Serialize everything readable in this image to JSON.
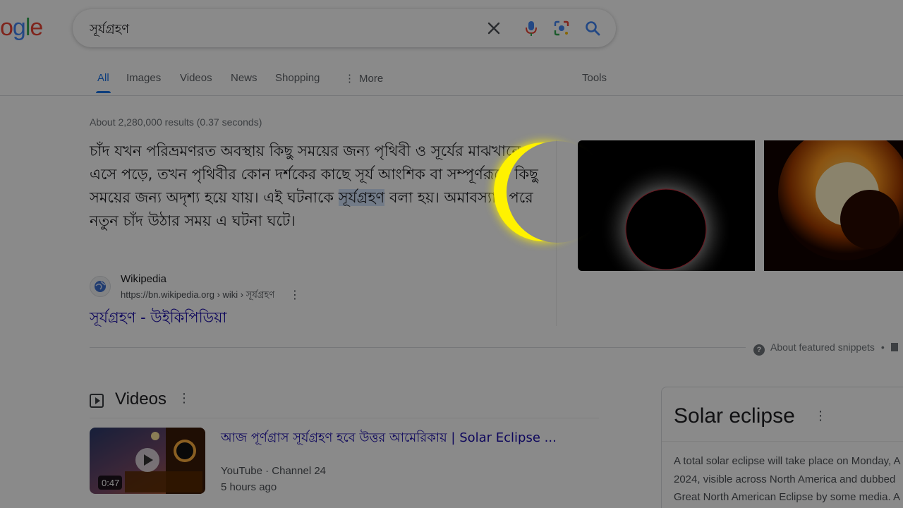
{
  "logo": {
    "part1": "o",
    "part2": "g",
    "part3": "l",
    "part4": "e"
  },
  "search": {
    "query": "সূর্যগ্রহণ"
  },
  "tabs": [
    {
      "label": "All"
    },
    {
      "label": "Images"
    },
    {
      "label": "Videos"
    },
    {
      "label": "News"
    },
    {
      "label": "Shopping"
    },
    {
      "label": "More"
    },
    {
      "label": "Tools"
    }
  ],
  "results_stats": "About 2,280,000 results (0.37 seconds)",
  "snippet": {
    "text_before": "চাঁদ যখন পরিভ্রমণরত অবস্থায় কিছু সময়ের জন্য পৃথিবী ও সূর্যের মাঝখানে এসে পড়ে, তখন পৃথিবীর কোন দর্শকের কাছে সূর্য আংশিক বা সম্পূর্ণরূপে কিছু সময়ের জন্য অদৃশ্য হয়ে যায়। এই ঘটনাকে ",
    "highlight": "সূর্যগ্রহণ",
    "text_after": " বলা হয়। অমাবস্যার পরে নতুন চাঁদ উঠার সময় এ ঘটনা ঘটে।"
  },
  "source": {
    "name": "Wikipedia",
    "url_prefix": "https://bn.wikipedia.org › wiki › ",
    "url_tail": "সূর্যগ্রহণ",
    "title": "সূর্যগ্রহণ - উইকিপিডিয়া"
  },
  "about_snippets": "About featured snippets",
  "videos": {
    "heading": "Videos",
    "items": [
      {
        "title": "আজ পূর্ণগ্রাস সূর্যগ্রহণ হবে উত্তর আমেরিকায় | Solar Eclipse ...",
        "source": "YouTube · Channel 24",
        "time": "5 hours ago",
        "duration": "0:47"
      }
    ]
  },
  "knowledge_panel": {
    "title": "Solar eclipse",
    "text_lines": [
      "A total solar eclipse will take place on Monday, A",
      "2024, visible across North America and dubbed",
      "Great North American Eclipse by some media. A"
    ]
  },
  "colors": {
    "link": "#1a0dab",
    "accent": "#1a73e8",
    "overlay": "rgba(0,0,0,0.46)",
    "highlight": "#fff200"
  }
}
